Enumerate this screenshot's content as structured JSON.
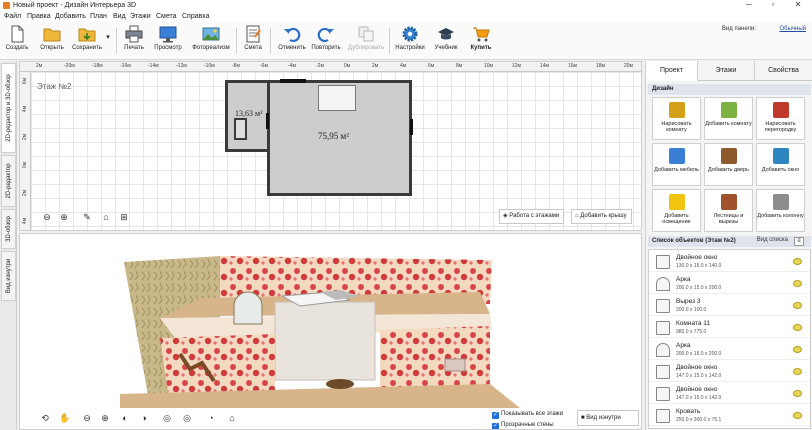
{
  "window": {
    "title": "Новый проект - Дизайн Интерьера 3D"
  },
  "menu": [
    "Файл",
    "Правка",
    "Добавить",
    "План",
    "Вид",
    "Этажи",
    "Смета",
    "Справка"
  ],
  "panel_view": {
    "label": "Вид панели:",
    "value": "Обычный"
  },
  "toolbar": {
    "create": "Создать",
    "open": "Открыть",
    "save": "Сохранить",
    "print": "Печать",
    "preview": "Просмотр",
    "photorealism": "Фотореализм",
    "estimate": "Смета",
    "undo": "Отменить",
    "redo": "Повторить",
    "duplicate": "Дублировать",
    "settings": "Настройки",
    "tutorial": "Учебник",
    "buy": "Купить"
  },
  "left_tabs": [
    "2D-редактор и 3D-обзор",
    "2D-редактор",
    "3D-обзор",
    "Вид изнутри"
  ],
  "plan": {
    "floor_label": "Этаж №2",
    "ruler_x": [
      "2м",
      "-20м",
      "-18м",
      "-16м",
      "-14м",
      "-12м",
      "-10м",
      "-8м",
      "-6м",
      "-4м",
      "-2м",
      "0м",
      "2м",
      "4м",
      "6м",
      "8м",
      "10м",
      "12м",
      "14м",
      "16м",
      "18м",
      "20м",
      "2"
    ],
    "ruler_y": [
      "6м",
      "4м",
      "2м",
      "0м",
      "2м",
      "4м",
      "6м"
    ],
    "rooms": [
      {
        "area": "13,63 м²"
      },
      {
        "area": "75,95 м²"
      }
    ],
    "floors_button": "Работа с этажами",
    "roof_button": "Добавить крышу"
  },
  "view3d": {
    "show_all_floors": "Показывать все этажи",
    "transparent_walls": "Прозрачные стены",
    "inside_view": "Вид изнутри"
  },
  "right_panel": {
    "tabs": [
      "Проект",
      "Этажи",
      "Свойства"
    ],
    "design_header": "Дизайн",
    "tools": [
      {
        "label": "Нарисовать комнату",
        "icon": "draw-room-icon",
        "color": "#d4a017"
      },
      {
        "label": "Добавить комнату",
        "icon": "add-room-icon",
        "color": "#7cb342"
      },
      {
        "label": "Нарисовать перегородку",
        "icon": "draw-partition-icon",
        "color": "#c0392b"
      },
      {
        "label": "Добавить мебель",
        "icon": "add-furniture-icon",
        "color": "#3a7fd5"
      },
      {
        "label": "Добавить дверь",
        "icon": "add-door-icon",
        "color": "#8e5a2b"
      },
      {
        "label": "Добавить окно",
        "icon": "add-window-icon",
        "color": "#2e86c1"
      },
      {
        "label": "Добавить освещение",
        "icon": "add-lighting-icon",
        "color": "#f1c40f"
      },
      {
        "label": "Лестницы и вырезы",
        "icon": "stairs-icon",
        "color": "#a0522d"
      },
      {
        "label": "Добавить колонну",
        "icon": "add-column-icon",
        "color": "#8d8d8d"
      }
    ],
    "objects_header": "Список объектов (Этаж №2)",
    "list_view_label": "Вид списка",
    "objects": [
      {
        "name": "Двойное окно",
        "dims": "130.0 x 15.0 x 140.0",
        "icon": "double-window-icon"
      },
      {
        "name": "Арка",
        "dims": "200.0 x 15.0 x 200.0",
        "icon": "arch-icon"
      },
      {
        "name": "Вырез 3",
        "dims": "200.0 x 100.0",
        "icon": "cutout-icon"
      },
      {
        "name": "Комната 11",
        "dims": "980.0 x 775.0",
        "icon": "room-icon"
      },
      {
        "name": "Арка",
        "dims": "200.0 x 15.0 x 200.0",
        "icon": "arch-icon"
      },
      {
        "name": "Двойное окно",
        "dims": "147.0 x 15.0 x 142.0",
        "icon": "double-window-icon"
      },
      {
        "name": "Двойное окно",
        "dims": "147.0 x 15.0 x 142.0",
        "icon": "double-window-icon"
      },
      {
        "name": "Кровать",
        "dims": "250.0 x 300.0 x 75.1",
        "icon": "bed-icon"
      }
    ]
  }
}
